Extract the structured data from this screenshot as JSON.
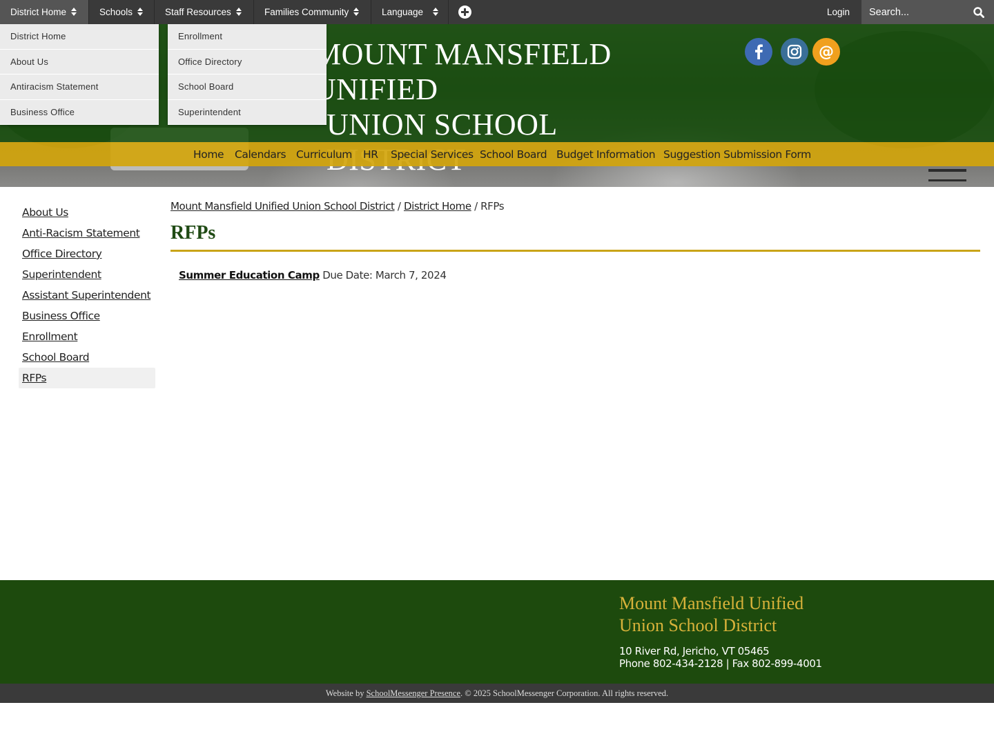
{
  "topnav": {
    "items": [
      {
        "label": "District Home"
      },
      {
        "label": "Schools"
      },
      {
        "label": "Staff Resources"
      },
      {
        "label": "Families Community"
      },
      {
        "label": "Language"
      }
    ],
    "login_label": "Login",
    "search_placeholder": "Search..."
  },
  "dropdown": {
    "column1": [
      "District Home",
      "About Us",
      "Antiracism Statement",
      "Business Office"
    ],
    "column2": [
      "Enrollment",
      "Office Directory",
      "School Board",
      "Superintendent"
    ]
  },
  "header": {
    "title_line1": "MOUNT MANSFIELD UNIFIED",
    "title_line2": "UNION SCHOOL DISTRICT",
    "social": [
      {
        "icon": "facebook-icon",
        "color": "#3e6ab3"
      },
      {
        "icon": "instagram-icon",
        "color": "#3a6f98"
      },
      {
        "icon": "email-icon",
        "color": "#f0a01e"
      }
    ]
  },
  "mainnav": {
    "items": [
      "Home",
      "Calendars",
      "Curriculum",
      "HR",
      "Special Services",
      "School Board",
      "Budget Information",
      "Suggestion Submission Form"
    ]
  },
  "sidebar": {
    "items": [
      "About Us",
      "Anti-Racism Statement",
      "Office Directory",
      "Superintendent",
      "Assistant Superintendent",
      "Business Office",
      "Enrollment",
      "School Board",
      "RFPs"
    ],
    "current": "RFPs"
  },
  "breadcrumb": {
    "root": "Mount Mansfield Unified Union School District",
    "parent": "District Home",
    "current": "RFPs",
    "separator": "/"
  },
  "page": {
    "title": "RFPs",
    "rfps": [
      {
        "link": "Summer Education Camp",
        "detail": "Due Date: March 7, 2024"
      }
    ]
  },
  "footer": {
    "name_line1": "Mount Mansfield Unified",
    "name_line2": "Union School District",
    "address": "10 River Rd, Jericho, VT 05465",
    "phone_fax": "Phone 802-434-2128 | Fax 802-899-4001"
  },
  "copyright": {
    "prefix": "Website by",
    "link": "SchoolMessenger Presence",
    "suffix": ". © 2025 SchoolMessenger Corporation. All rights reserved."
  },
  "colors": {
    "brand_green": "#1d4a0d",
    "brand_gold": "#d2a50c",
    "topbar": "#3a3a3a"
  }
}
